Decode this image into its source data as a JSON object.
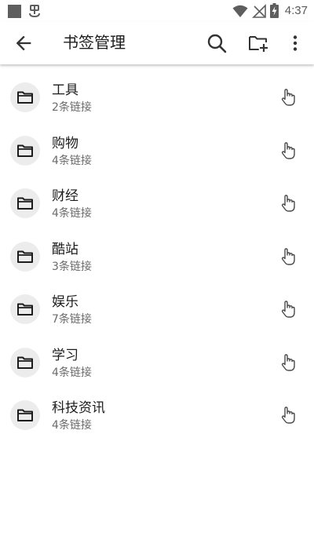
{
  "status_bar": {
    "time": "4:37",
    "icons": [
      "notification-square-icon",
      "app-notification-icon",
      "wifi-icon",
      "no-signal-icon",
      "battery-charging-icon"
    ]
  },
  "header": {
    "title": "书签管理",
    "actions": [
      "back-arrow-icon",
      "search-icon",
      "folder-add-icon",
      "more-vert-icon"
    ]
  },
  "folders": [
    {
      "name": "工具",
      "count": "2条链接"
    },
    {
      "name": "购物",
      "count": "4条链接"
    },
    {
      "name": "财经",
      "count": "4条链接"
    },
    {
      "name": "酷站",
      "count": "3条链接"
    },
    {
      "name": "娱乐",
      "count": "7条链接"
    },
    {
      "name": "学习",
      "count": "4条链接"
    },
    {
      "name": "科技资讯",
      "count": "4条链接"
    }
  ],
  "colors": {
    "icon": "#333333",
    "avatar_bg": "#ececec",
    "subtitle": "#6b6b6b"
  }
}
